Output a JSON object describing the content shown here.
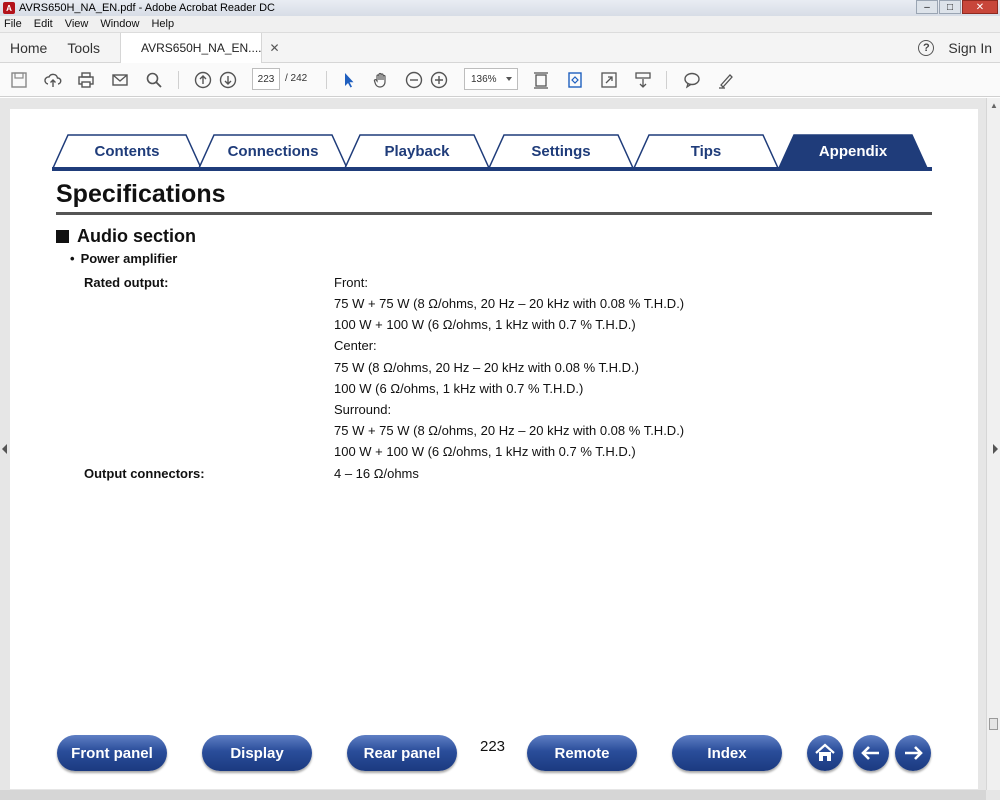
{
  "window": {
    "title": "AVRS650H_NA_EN.pdf - Adobe Acrobat Reader DC"
  },
  "menu": [
    "File",
    "Edit",
    "View",
    "Window",
    "Help"
  ],
  "apptabs": {
    "home": "Home",
    "tools": "Tools",
    "doc_tab": "AVRS650H_NA_EN....",
    "sign_in": "Sign In"
  },
  "toolbar": {
    "page_current": "223",
    "page_total": "/ 242",
    "zoom": "136%"
  },
  "section_tabs": [
    {
      "label": "Contents",
      "active": false
    },
    {
      "label": "Connections",
      "active": false
    },
    {
      "label": "Playback",
      "active": false
    },
    {
      "label": "Settings",
      "active": false
    },
    {
      "label": "Tips",
      "active": false
    },
    {
      "label": "Appendix",
      "active": true
    }
  ],
  "page": {
    "heading": "Specifications",
    "section": "Audio section",
    "subsection": "Power amplifier",
    "specs": [
      {
        "label": "Rated output:",
        "lines": [
          "Front:",
          "75 W + 75 W (8 Ω/ohms, 20 Hz – 20 kHz with 0.08 % T.H.D.)",
          "100 W + 100 W (6 Ω/ohms, 1 kHz with 0.7 % T.H.D.)",
          "Center:",
          "75 W (8 Ω/ohms, 20 Hz – 20 kHz with 0.08 % T.H.D.)",
          "100 W (6 Ω/ohms, 1 kHz with 0.7 % T.H.D.)",
          "Surround:",
          "75 W + 75 W (8 Ω/ohms, 20 Hz – 20 kHz with 0.08 % T.H.D.)",
          "100 W + 100 W (6 Ω/ohms, 1 kHz with 0.7 % T.H.D.)"
        ]
      },
      {
        "label": "Output connectors:",
        "lines": [
          "4 – 16 Ω/ohms"
        ]
      }
    ],
    "page_number": "223"
  },
  "bottom_nav": [
    "Front panel",
    "Display",
    "Rear panel",
    "Remote",
    "Index"
  ],
  "colors": {
    "tab_blue": "#1f3c7a",
    "button_blue": "#2a4d9a"
  }
}
